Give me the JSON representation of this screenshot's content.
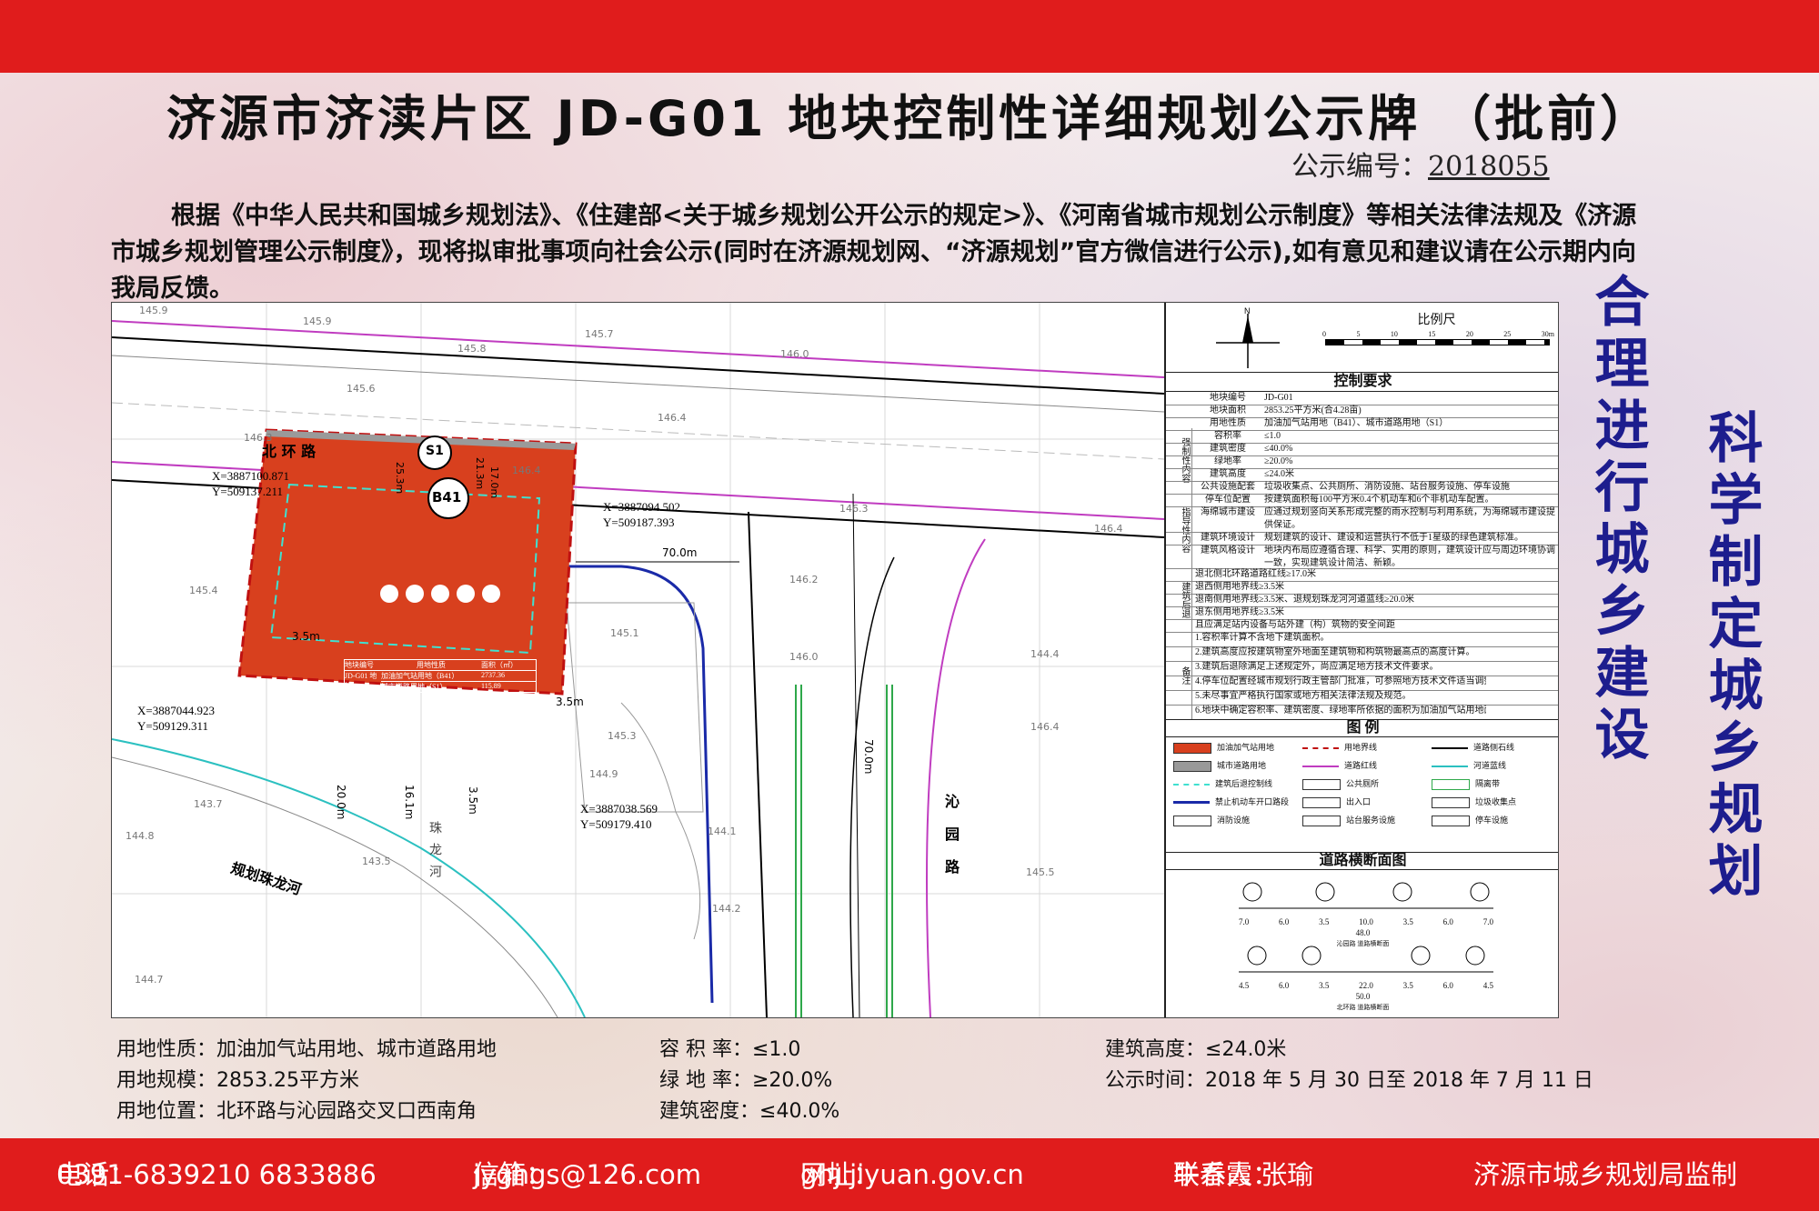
{
  "header": {
    "title": "济源市济渎片区 JD-G01 地块控制性详细规划公示牌 （批前）",
    "notice_label": "公示编号：",
    "notice_number": "2018055"
  },
  "intro": "根据《中华人民共和国城乡规划法》、《住建部<关于城乡规划公开公示的规定>》、《河南省城市规划公示制度》等相关法律法规及《济源市城乡规划管理公示制度》，现将拟审批事项向社会公示(同时在济源规划网、“济源规划”官方微信进行公示),如有意见和建议请在公示期内向我局反馈。",
  "map": {
    "roads": {
      "north": "北 环 路",
      "east": "沁园路",
      "river_plan": "规划珠龙河",
      "river_name": "珠龙河"
    },
    "coords": [
      {
        "x": "X=3887100.871",
        "y": "Y=509137.211"
      },
      {
        "x": "X=3887094.502",
        "y": "Y=509187.393"
      },
      {
        "x": "X=3887044.923",
        "y": "Y=509129.311"
      },
      {
        "x": "X=3887038.569",
        "y": "Y=509179.410"
      }
    ],
    "dims": {
      "d1": "70.0m",
      "d2": "70.0m",
      "d3": "3.5m",
      "d4": "3.5m",
      "d5": "3.5m",
      "d6": "20.0m",
      "d7": "16.1m",
      "d8": "25.3m",
      "d9": "21.3m",
      "d10": "17.0m"
    },
    "elevations": [
      "145.9",
      "145.9",
      "145.8",
      "145.7",
      "145.6",
      "146.0",
      "146.3",
      "146.4",
      "146.4",
      "146.4",
      "146.3",
      "146.2",
      "145.4",
      "145.1",
      "146.0",
      "145.3",
      "144.9",
      "143.7",
      "144.8",
      "143.5",
      "144.2",
      "144.7",
      "145.5",
      "144.4",
      "144.1",
      "146.4"
    ],
    "plot_labels": {
      "s1": "S1",
      "b41": "B41"
    },
    "inner_table": {
      "headers": [
        "地块编号",
        "用地性质",
        "面积（㎡）"
      ],
      "plot_id": "JD-G01 地块",
      "rows": [
        [
          "加油加气站用地（B41）",
          "2737.36"
        ],
        [
          "城市道路用地（S1）",
          "115.89"
        ]
      ]
    }
  },
  "panel": {
    "scale_title": "比例尺",
    "scale_ticks": [
      "0",
      "5",
      "10",
      "15",
      "20",
      "25",
      "30m"
    ],
    "control_title": "控制要求",
    "sections": {
      "mandatory": "强制性内容",
      "guiding": "指导性内容",
      "setback": "建筑后退",
      "notes": "备注"
    },
    "rows": [
      [
        "地块编号",
        "JD-G01"
      ],
      [
        "地块面积",
        "2853.25平方米(合4.28亩)"
      ],
      [
        "用地性质",
        "加油加气站用地（B41）、城市道路用地（S1）"
      ],
      [
        "容积率",
        "≤1.0"
      ],
      [
        "建筑密度",
        "≤40.0%"
      ],
      [
        "绿地率",
        "≥20.0%"
      ],
      [
        "建筑高度",
        "≤24.0米"
      ],
      [
        "公共设施配套",
        "垃圾收集点、公共厕所、消防设施、站台服务设施、停车设施"
      ],
      [
        "停车位配置",
        "按建筑面积每100平方米0.4个机动车和6个非机动车配置。"
      ],
      [
        "海绵城市建设",
        "应通过规划竖向关系形成完整的雨水控制与利用系统，为海绵城市建设提供保证。"
      ],
      [
        "建筑环境设计",
        "规划建筑的设计、建设和运营执行不低于1星级的绿色建筑标准。"
      ],
      [
        "建筑风格设计",
        "地块内布局应遵循合理、科学、实用的原则，建筑设计应与周边环境协调一致，实现建筑设计简洁、新颖。"
      ]
    ],
    "setback_rows": [
      "退北侧北环路道路红线≥17.0米",
      "退西侧用地界线≥3.5米",
      "退南侧用地界线≥3.5米、退规划珠龙河河道蓝线≥20.0米",
      "退东侧用地界线≥3.5米",
      "且应满足站内设备与站外建（构）筑物的安全间距"
    ],
    "notes_rows": [
      "1.容积率计算不含地下建筑面积。",
      "2.建筑高度应按建筑物室外地面至建筑物和构筑物最高点的高度计算。",
      "3.建筑后退除满足上述规定外，尚应满足地方技术文件要求。",
      "4.停车位配置经城市规划行政主管部门批准，可参照地方技术文件适当调整。",
      "5.未尽事宜严格执行国家或地方相关法律法规及规范。",
      "6.地块中确定容积率、建筑密度、绿地率所依据的面积为加油加气站用地面积"
    ],
    "legend_title": "图  例",
    "legend": [
      {
        "label": "加油加气站用地",
        "color": "#d8401e",
        "text": "B41"
      },
      {
        "label": "用地界线",
        "color": "#ffffff"
      },
      {
        "label": "道路侧石线",
        "color": "#ffffff"
      },
      {
        "label": "城市道路用地",
        "color": "#999999",
        "text": "S1"
      },
      {
        "label": "道路红线",
        "color": "#ffffff"
      },
      {
        "label": "河道蓝线",
        "color": "#ffffff"
      },
      {
        "label": "建筑后退控制线",
        "color": "#ffffff"
      },
      {
        "label": "公共厕所",
        "color": "#ffffff"
      },
      {
        "label": "隔离带",
        "color": "#ffffff"
      },
      {
        "label": "禁止机动车开口路段",
        "color": "#ffffff"
      },
      {
        "label": "出入口",
        "color": "#ffffff"
      },
      {
        "label": "垃圾收集点",
        "color": "#ffffff"
      },
      {
        "label": "消防设施",
        "color": "#ffffff"
      },
      {
        "label": "站台服务设施",
        "color": "#ffffff"
      },
      {
        "label": "停车设施",
        "color": "#ffffff"
      }
    ],
    "xs_title": "道路横断面图",
    "xs1": {
      "dims": [
        "7.0",
        "6.0",
        "3.5",
        "10.0",
        "3.5",
        "6.0",
        "7.0"
      ],
      "total": "48.0",
      "name": "沁园路 道路横断面"
    },
    "xs2": {
      "dims": [
        "4.5",
        "6.0",
        "3.5",
        "22.0",
        "3.5",
        "6.0",
        "4.5"
      ],
      "total": "50.0",
      "name": "北环路 道路横断面"
    }
  },
  "slogans": {
    "left": "合理进行城乡建设",
    "right": "科学制定城乡规划"
  },
  "info": {
    "use_label": "用地性质：",
    "use": "加油加气站用地、城市道路用地",
    "scale_label": "用地规模：",
    "scale": "2853.25平方米",
    "loc_label": "用地位置：",
    "loc": "北环路与沁园路交叉口西南角",
    "far_label": "容 积 率：",
    "far": "≤1.0",
    "green_label": "绿 地 率：",
    "green": "≥20.0%",
    "density_label": "建筑密度：",
    "density": "≤40.0%",
    "height_label": "建筑高度：",
    "height": "≤24.0米",
    "period_label": "公示时间：",
    "period": "2018 年 5 月 30 日至 2018 年 7 月 11 日"
  },
  "footer": {
    "phone_label": "电话：",
    "phone": "0391-6839210 6833886",
    "email_label": "信箱：",
    "email": "jyghgs@126.com",
    "site_label": "网址：",
    "site": "ghj.jiyuan.gov.cn",
    "contact_label": "联系人：",
    "contact": "牛春霞 张瑜",
    "supervisor": "济源市城乡规划局监制"
  },
  "colors": {
    "red_band": "#e01c1c",
    "plot": "#d8401e",
    "slogan": "#1d1d8e",
    "road_red": "#c8c",
    "road_blue": "#1a2aa8"
  }
}
